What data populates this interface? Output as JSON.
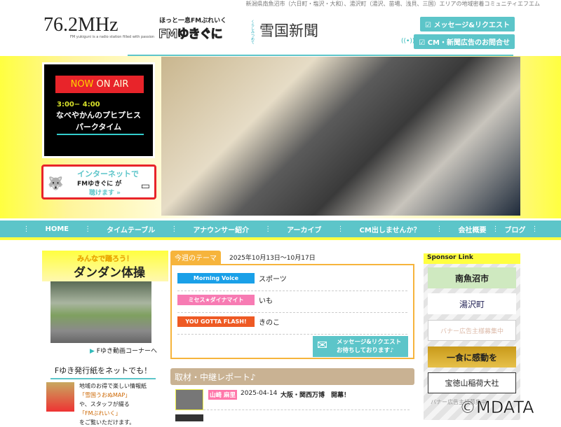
{
  "header": {
    "tagline": "新潟県南魚沼市（六日町・塩沢・大和）、湯沢町（湯沢、苗場、浅貝、三国）エリアの地域密着コミュニティエフエム",
    "frequency": "76.2MHz",
    "logo_sub": "FM yukiguni is a radio station filled with passion",
    "logo_kana": "ほっと一息FMぶれいく",
    "logo_name": "FMゆきぐに",
    "paper_kana": "くらしみつめて",
    "paper": "雪国新聞",
    "btn_message": "☑ メッセージ&リクエスト",
    "btn_cm": "☑ CM・新聞広告のお問合せ"
  },
  "onair": {
    "tag_now": "NOW",
    "tag_rest": " ON AIR",
    "time": "3:00− 4:00",
    "title": "なべやかんのプヒプヒスパークタイム"
  },
  "internet": {
    "line1": "インターネットで",
    "line2": "FMゆきぐに が",
    "line3": "聴けます »"
  },
  "nav": [
    "HOME",
    "タイムテーブル",
    "アナウンサー紹介",
    "アーカイブ",
    "CM出しませんか？",
    "会社概要",
    "ブログ"
  ],
  "left": {
    "dd_kana": "みんなで踊ろう！",
    "dd_title": "ダンダン体操",
    "video_link": "Fゆき動画コーナーへ",
    "fyuki_title": "Fゆき発行紙をネットでも！",
    "fy_l1": "地域のお得で楽しい情報紙",
    "fy_l2": "「雪国うおぬMAP」",
    "fy_l3": "や、スタッフが綴る",
    "fy_l4": "「FMぶれいく」",
    "fy_l5": "をご覧いただけます。"
  },
  "theme": {
    "tab": "今週のテーマ",
    "date": "2025年10月13日〜10月17日",
    "rows": [
      {
        "program": "Morning Voice",
        "topic": "スポーツ",
        "color": "#1aa0e8"
      },
      {
        "program": "ミセス★ダイナマイト",
        "topic": "いも",
        "color": "#f77bb3"
      },
      {
        "program": "YOU GOTTA FLASH!",
        "topic": "きのこ",
        "color": "#ee5a24"
      }
    ],
    "msg_l1": "メッセージ&リクエスト",
    "msg_l2": "お待ちしております♪"
  },
  "report": {
    "title": "取材・中継レポート♪",
    "items": [
      {
        "who": "山崎 麻里",
        "date": "2025-04-14",
        "title": "大阪・関西万博　開幕！"
      }
    ]
  },
  "sponsor": {
    "title": "Sponsor Link",
    "banners": [
      "南魚沼市",
      "湯沢町",
      "バナー広告主様募集中",
      "一食に感動を",
      "宝徳山稲荷大社"
    ],
    "footer": "バナー広告主様募集中"
  },
  "watermark": "©MDATA"
}
